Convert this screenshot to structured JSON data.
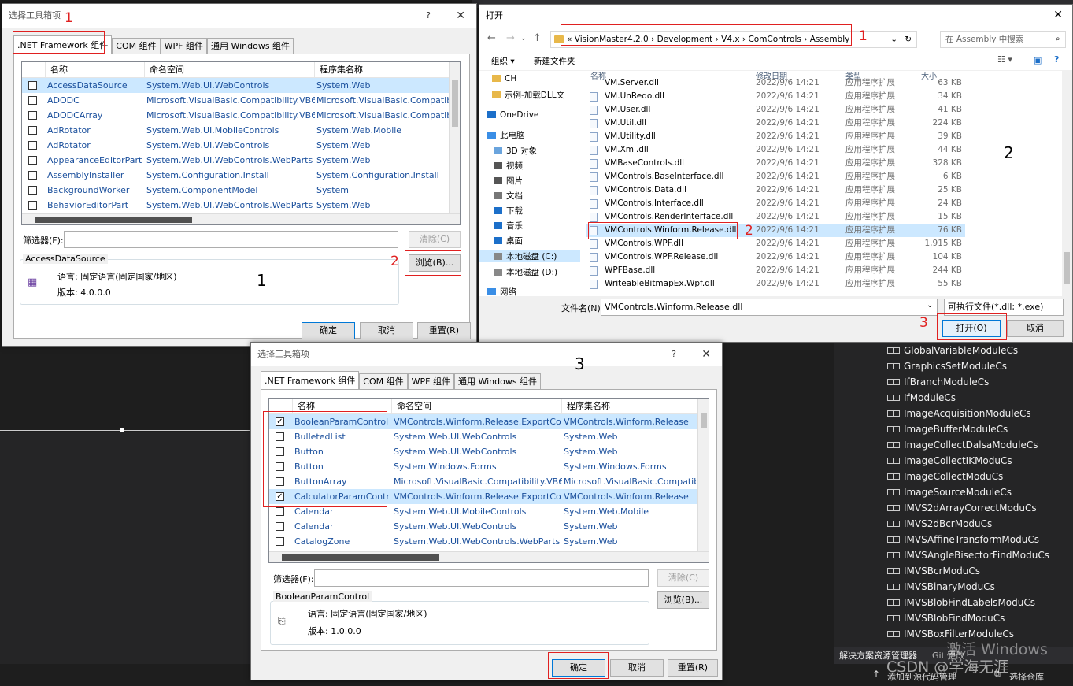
{
  "dialog1": {
    "title": "选择工具箱项",
    "help": "?",
    "close": "✕",
    "tabs": [
      ".NET Framework 组件",
      "COM 组件",
      "WPF 组件",
      "通用 Windows 组件"
    ],
    "columns": [
      "名称",
      "命名空间",
      "程序集名称"
    ],
    "rows": [
      {
        "name": "AccessDataSource",
        "ns": "System.Web.UI.WebControls",
        "asm": "System.Web"
      },
      {
        "name": "ADODC",
        "ns": "Microsoft.VisualBasic.Compatibility.VB6",
        "asm": "Microsoft.VisualBasic.Compatibi"
      },
      {
        "name": "ADODCArray",
        "ns": "Microsoft.VisualBasic.Compatibility.VB6",
        "asm": "Microsoft.VisualBasic.Compatibi"
      },
      {
        "name": "AdRotator",
        "ns": "System.Web.UI.MobileControls",
        "asm": "System.Web.Mobile"
      },
      {
        "name": "AdRotator",
        "ns": "System.Web.UI.WebControls",
        "asm": "System.Web"
      },
      {
        "name": "AppearanceEditorPart",
        "ns": "System.Web.UI.WebControls.WebParts",
        "asm": "System.Web"
      },
      {
        "name": "AssemblyInstaller",
        "ns": "System.Configuration.Install",
        "asm": "System.Configuration.Install"
      },
      {
        "name": "BackgroundWorker",
        "ns": "System.ComponentModel",
        "asm": "System"
      },
      {
        "name": "BehaviorEditorPart",
        "ns": "System.Web.UI.WebControls.WebParts",
        "asm": "System.Web"
      }
    ],
    "filter_label": "筛选器(F):",
    "clear": "清除(C)",
    "browse": "浏览(B)...",
    "group_title": "AccessDataSource",
    "lang": "语言:  固定语言(固定国家/地区)",
    "version": "版本:  4.0.0.0",
    "ok": "确定",
    "cancel": "取消",
    "reset": "重置(R)"
  },
  "explorer": {
    "title": "打开",
    "close": "✕",
    "address": [
      "VisionMaster4.2.0",
      "Development",
      "V4.x",
      "ComControls",
      "Assembly"
    ],
    "address_prefix": "«",
    "search_placeholder": "在 Assembly 中搜索",
    "organize": "组织 ▾",
    "new_folder": "新建文件夹",
    "nav": [
      {
        "label": "CH",
        "icon": "folder-icon"
      },
      {
        "label": "示例-加载DLL文",
        "icon": "folder-icon"
      },
      {
        "label": "OneDrive",
        "icon": "cloud-icon"
      },
      {
        "label": "此电脑",
        "icon": "computer-icon"
      },
      {
        "label": "3D 对象",
        "icon": "cube-icon"
      },
      {
        "label": "视频",
        "icon": "video-icon"
      },
      {
        "label": "图片",
        "icon": "picture-icon"
      },
      {
        "label": "文档",
        "icon": "document-icon"
      },
      {
        "label": "下载",
        "icon": "download-icon"
      },
      {
        "label": "音乐",
        "icon": "music-icon"
      },
      {
        "label": "桌面",
        "icon": "desktop-icon"
      },
      {
        "label": "本地磁盘 (C:)",
        "icon": "drive-icon"
      },
      {
        "label": "本地磁盘 (D:)",
        "icon": "drive-icon"
      },
      {
        "label": "网络",
        "icon": "network-icon"
      }
    ],
    "columns": [
      "名称",
      "修改日期",
      "类型",
      "大小"
    ],
    "files": [
      {
        "name": "VM.Server.dll",
        "date": "2022/9/6 14:21",
        "type": "应用程序扩展",
        "size": "63 KB"
      },
      {
        "name": "VM.UnRedo.dll",
        "date": "2022/9/6 14:21",
        "type": "应用程序扩展",
        "size": "34 KB"
      },
      {
        "name": "VM.User.dll",
        "date": "2022/9/6 14:21",
        "type": "应用程序扩展",
        "size": "41 KB"
      },
      {
        "name": "VM.Util.dll",
        "date": "2022/9/6 14:21",
        "type": "应用程序扩展",
        "size": "224 KB"
      },
      {
        "name": "VM.Utility.dll",
        "date": "2022/9/6 14:21",
        "type": "应用程序扩展",
        "size": "39 KB"
      },
      {
        "name": "VM.Xml.dll",
        "date": "2022/9/6 14:21",
        "type": "应用程序扩展",
        "size": "44 KB"
      },
      {
        "name": "VMBaseControls.dll",
        "date": "2022/9/6 14:21",
        "type": "应用程序扩展",
        "size": "328 KB"
      },
      {
        "name": "VMControls.BaseInterface.dll",
        "date": "2022/9/6 14:21",
        "type": "应用程序扩展",
        "size": "6 KB"
      },
      {
        "name": "VMControls.Data.dll",
        "date": "2022/9/6 14:21",
        "type": "应用程序扩展",
        "size": "25 KB"
      },
      {
        "name": "VMControls.Interface.dll",
        "date": "2022/9/6 14:21",
        "type": "应用程序扩展",
        "size": "24 KB"
      },
      {
        "name": "VMControls.RenderInterface.dll",
        "date": "2022/9/6 14:21",
        "type": "应用程序扩展",
        "size": "15 KB"
      },
      {
        "name": "VMControls.Winform.Release.dll",
        "date": "2022/9/6 14:21",
        "type": "应用程序扩展",
        "size": "76 KB"
      },
      {
        "name": "VMControls.WPF.dll",
        "date": "2022/9/6 14:21",
        "type": "应用程序扩展",
        "size": "1,915 KB"
      },
      {
        "name": "VMControls.WPF.Release.dll",
        "date": "2022/9/6 14:21",
        "type": "应用程序扩展",
        "size": "104 KB"
      },
      {
        "name": "WPFBase.dll",
        "date": "2022/9/6 14:21",
        "type": "应用程序扩展",
        "size": "244 KB"
      },
      {
        "name": "WriteableBitmapEx.Wpf.dll",
        "date": "2022/9/6 14:21",
        "type": "应用程序扩展",
        "size": "55 KB"
      }
    ],
    "filename_label": "文件名(N):",
    "filename_value": "VMControls.Winform.Release.dll",
    "filetype": "可执行文件(*.dll; *.exe)",
    "open": "打开(O)",
    "cancel": "取消"
  },
  "dialog3": {
    "title": "选择工具箱项",
    "help": "?",
    "close": "✕",
    "tabs": [
      ".NET Framework 组件",
      "COM 组件",
      "WPF 组件",
      "通用 Windows 组件"
    ],
    "columns": [
      "名称",
      "命名空间",
      "程序集名称"
    ],
    "rows": [
      {
        "checked": true,
        "name": "BooleanParamControl",
        "ns": "VMControls.Winform.Release.ExportCo",
        "asm": "VMControls.Winform.Release"
      },
      {
        "checked": false,
        "name": "BulletedList",
        "ns": "System.Web.UI.WebControls",
        "asm": "System.Web"
      },
      {
        "checked": false,
        "name": "Button",
        "ns": "System.Web.UI.WebControls",
        "asm": "System.Web"
      },
      {
        "checked": false,
        "name": "Button",
        "ns": "System.Windows.Forms",
        "asm": "System.Windows.Forms"
      },
      {
        "checked": false,
        "name": "ButtonArray",
        "ns": "Microsoft.VisualBasic.Compatibility.VB6",
        "asm": "Microsoft.VisualBasic.Compatibi"
      },
      {
        "checked": true,
        "name": "CalculatorParamContr",
        "ns": "VMControls.Winform.Release.ExportCo",
        "asm": "VMControls.Winform.Release"
      },
      {
        "checked": false,
        "name": "Calendar",
        "ns": "System.Web.UI.MobileControls",
        "asm": "System.Web.Mobile"
      },
      {
        "checked": false,
        "name": "Calendar",
        "ns": "System.Web.UI.WebControls",
        "asm": "System.Web"
      },
      {
        "checked": false,
        "name": "CatalogZone",
        "ns": "System.Web.UI.WebControls.WebParts",
        "asm": "System.Web"
      }
    ],
    "filter_label": "筛选器(F):",
    "clear": "清除(C)",
    "browse": "浏览(B)...",
    "group_title": "BooleanParamControl",
    "lang": "语言:  固定语言(固定国家/地区)",
    "version": "版本:  1.0.0.0",
    "ok": "确定",
    "cancel": "取消",
    "reset": "重置(R)"
  },
  "vs": {
    "tree": [
      "GlobalVariableModuleCs",
      "GraphicsSetModuleCs",
      "IfBranchModuleCs",
      "IfModuleCs",
      "ImageAcquisitionModuleCs",
      "ImageBufferModuleCs",
      "ImageCollectDalsaModuleCs",
      "ImageCollectIKModuCs",
      "ImageCollectModuCs",
      "ImageSourceModuleCs",
      "IMVS2dArrayCorrectModuCs",
      "IMVS2dBcrModuCs",
      "IMVSAffineTransformModuCs",
      "IMVSAngleBisectorFindModuCs",
      "IMVSBcrModuCs",
      "IMVSBinaryModuCs",
      "IMVSBlobFindLabelsModuCs",
      "IMVSBlobFindModuCs",
      "IMVSBoxFilterModuleCs"
    ],
    "tab_solution": "解决方案资源管理器",
    "tab_git": "Git 更改",
    "status_add": "添加到源代码管理",
    "status_repo": "选择仓库",
    "watermark_win": "激活 Windows",
    "watermark_csdn": "CSDN @学海无涯"
  },
  "annotations": {
    "d1_tab": "1",
    "d1_browse": "2",
    "d1_big": "1",
    "fe_addr": "1",
    "fe_file": "2",
    "fe_big": "2",
    "fe_open": "3",
    "d3_big": "3"
  }
}
